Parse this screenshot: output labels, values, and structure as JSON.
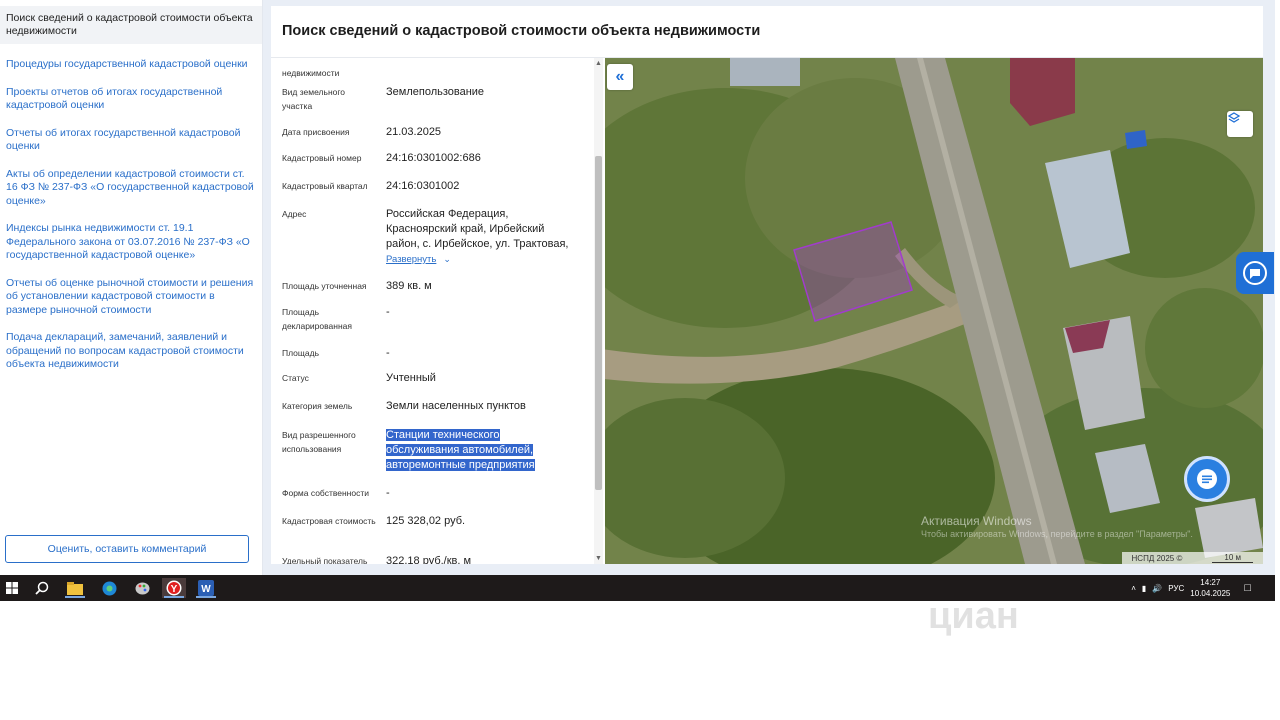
{
  "sidebar": {
    "active_item": "Поиск сведений о кадастровой стоимости объекта недвижимости",
    "items": [
      "Процедуры государственной кадастровой оценки",
      "Проекты отчетов об итогах государственной кадастровой оценки",
      "Отчеты об итогах государственной кадастровой оценки",
      "Акты об определении кадастровой стоимости ст. 16 ФЗ № 237-ФЗ «О государственной кадастровой оценке»",
      "Индексы рынка недвижимости ст. 19.1 Федерального закона от 03.07.2016 № 237-ФЗ «О государственной кадастровой оценке»",
      "Отчеты об оценке рыночной стоимости и решения об установлении кадастровой стоимости в размере рыночной стоимости",
      "Подача деклараций, замечаний, заявлений и обращений по вопросам кадастровой стоимости объекта недвижимости"
    ],
    "rate_button": "Оценить, оставить комментарий"
  },
  "panel": {
    "title": "Поиск сведений о кадастровой стоимости объекта недвижимости"
  },
  "attributes": {
    "top_cut_label": "недвижимости",
    "land_kind_label": "Вид земельного участка",
    "land_kind_value": "Землепользование",
    "date_label": "Дата присвоения",
    "date_value": "21.03.2025",
    "cad_number_label": "Кадастровый номер",
    "cad_number_value": "24:16:0301002:686",
    "cad_quarter_label": "Кадастровый квартал",
    "cad_quarter_value": "24:16:0301002",
    "address_label": "Адрес",
    "address_value": "Российская Федерация, Красноярский край, Ирбейский район, с. Ирбейское, ул. Трактовая,",
    "expand_link": "Развернуть",
    "area_specified_label": "Площадь уточненная",
    "area_specified_value": "389 кв. м",
    "area_declared_label": "Площадь декларированная",
    "area_declared_value": "-",
    "area_label": "Площадь",
    "area_value": "-",
    "status_label": "Статус",
    "status_value": "Учтенный",
    "category_label": "Категория земель",
    "category_value": "Земли населенных пунктов",
    "permitted_use_label": "Вид разрешенного использования",
    "permitted_use_line1": "Станции технического",
    "permitted_use_line2": "обслуживания автомобилей,",
    "permitted_use_line3": "авторемонтные предприятия",
    "ownership_label": "Форма собственности",
    "ownership_value": "-",
    "cad_cost_label": "Кадастровая стоимость",
    "cad_cost_value": "125 328,02 руб.",
    "specific_label": "Удельный показатель",
    "specific_value": "322,18 руб./кв. м"
  },
  "map": {
    "activate_title": "Активация Windows",
    "activate_sub": "Чтобы активировать Windows, перейдите в раздел \"Параметры\".",
    "attribution": "НСПД 2025 ©",
    "scale": "10 м",
    "parcel_color": "#a13ccc"
  },
  "taskbar": {
    "language": "РУС",
    "time": "14:27",
    "date": "10.04.2025"
  },
  "watermark": "циан"
}
